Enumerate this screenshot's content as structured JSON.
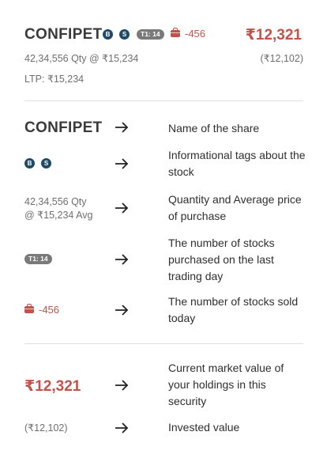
{
  "header": {
    "share_name": "CONFIPET",
    "tags": [
      "B",
      "S"
    ],
    "t1_label": "T1: 14",
    "sold_today": "-456",
    "current_value": "₹12,321",
    "quantity_avg": "42,34,556 Qty @ ₹15,234",
    "invested": "(₹12,102)",
    "ltp": "LTP: ₹15,234"
  },
  "legend": {
    "rows": [
      {
        "description": "Name of the share"
      },
      {
        "description": "Informational tags about the stock"
      },
      {
        "quantity_line1": "42,34,556 Qty",
        "quantity_line2": "@ ₹15,234 Avg",
        "description": "Quantity and Average price of purchase"
      },
      {
        "description": "The number of stocks purchased on the last trading day"
      },
      {
        "description": "The number of stocks sold today"
      },
      {
        "description": "Current market value of your holdings in this security"
      },
      {
        "description": "Invested value"
      }
    ]
  },
  "colors": {
    "accent_red": "#c0544a",
    "tag_blue": "#1f4b66",
    "pill_gray": "#7a7a7a"
  }
}
